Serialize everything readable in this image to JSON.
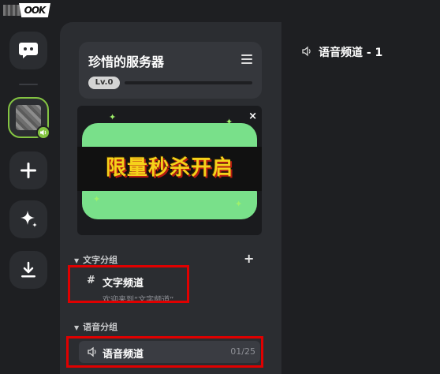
{
  "app": {
    "logo_text": "OOK"
  },
  "rail": {
    "items": [
      {
        "name": "messages",
        "icon": "chat-bubble-icon"
      },
      {
        "name": "server",
        "icon": "server-thumbnail"
      },
      {
        "name": "add",
        "icon": "plus-icon"
      },
      {
        "name": "discover",
        "icon": "sparkle-icon"
      },
      {
        "name": "download",
        "icon": "download-icon"
      }
    ],
    "active_server_voice_indicator": "#84c442"
  },
  "server": {
    "name": "珍惜的服务器",
    "level": "Lv.0",
    "level_progress": 0
  },
  "banner": {
    "text": "限量秒杀开启",
    "close_symbol": "×"
  },
  "groups": {
    "text_group": {
      "label": "文字分组",
      "add_symbol": "+"
    },
    "voice_group": {
      "label": "语音分组"
    }
  },
  "channels": {
    "text": {
      "prefix": "#",
      "name": "文字频道",
      "subtitle": "欢迎来到“文字频道”"
    },
    "voice": {
      "name": "语音频道",
      "count": "01/25"
    }
  },
  "main": {
    "title": "语音频道 - 1"
  },
  "colors": {
    "accent_green": "#84c442",
    "highlight_red": "#e00000",
    "banner_yellow": "#f6d21a",
    "banner_green": "#79e08a"
  }
}
